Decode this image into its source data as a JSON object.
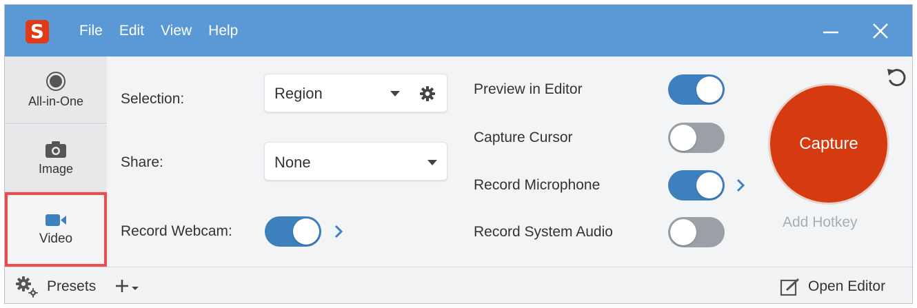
{
  "app": {
    "logo_letter": "S"
  },
  "menu": {
    "file": "File",
    "edit": "Edit",
    "view": "View",
    "help": "Help"
  },
  "tabs": [
    {
      "label": "All-in-One",
      "icon": "record-dot-icon"
    },
    {
      "label": "Image",
      "icon": "camera-icon"
    },
    {
      "label": "Video",
      "icon": "video-camera-icon",
      "selected": true
    }
  ],
  "settings": {
    "selection_label": "Selection:",
    "selection_value": "Region",
    "share_label": "Share:",
    "share_value": "None",
    "webcam_label": "Record Webcam:",
    "webcam_on": true
  },
  "toggles": [
    {
      "label": "Preview in Editor",
      "on": true
    },
    {
      "label": "Capture Cursor",
      "on": false
    },
    {
      "label": "Record Microphone",
      "on": true
    },
    {
      "label": "Record System Audio",
      "on": false
    }
  ],
  "capture": {
    "label": "Capture",
    "hotkey": "Add Hotkey",
    "color": "#d63a10"
  },
  "footer": {
    "presets": "Presets",
    "open_editor": "Open Editor"
  },
  "colors": {
    "titlebar": "#5b99d6",
    "toggle_on": "#3e7fbd",
    "toggle_off": "#9aa0a6",
    "highlight": "#ef4b4b"
  }
}
